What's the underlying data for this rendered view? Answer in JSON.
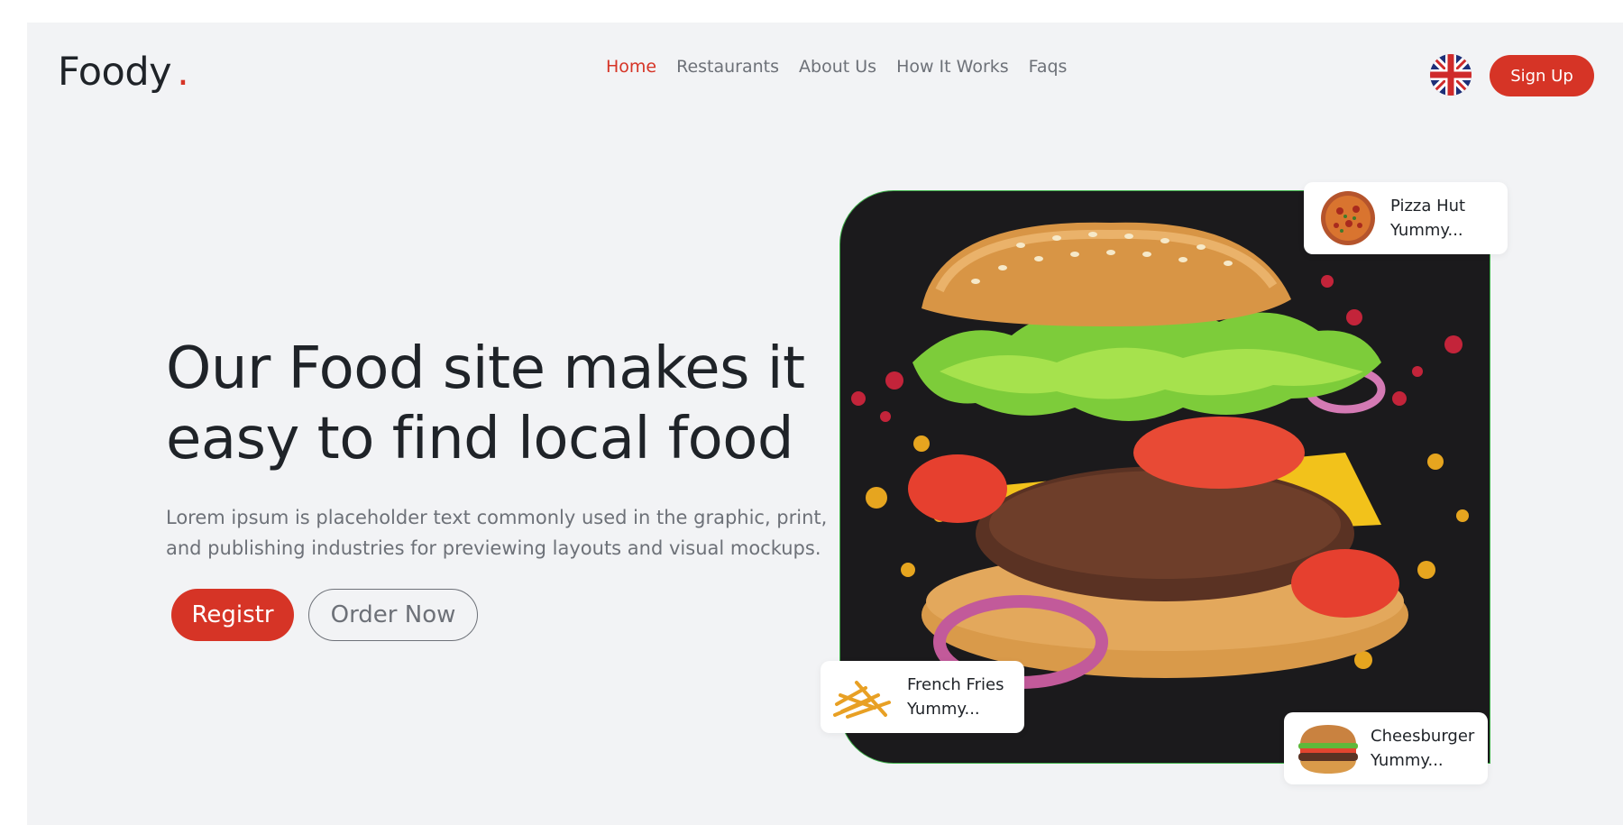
{
  "brand": {
    "name": "Foody",
    "dot": "."
  },
  "nav": {
    "items": [
      {
        "label": "Home",
        "active": true
      },
      {
        "label": "Restaurants",
        "active": false
      },
      {
        "label": "About Us",
        "active": false
      },
      {
        "label": "How It Works",
        "active": false
      },
      {
        "label": "Faqs",
        "active": false
      }
    ]
  },
  "header": {
    "flag_icon": "uk-flag-icon",
    "signup_label": "Sign Up"
  },
  "hero": {
    "title_line1": "Our Food site makes it",
    "title_line2": "easy to find local food",
    "description_line1": "Lorem ipsum is placeholder text commonly used in the graphic, print,",
    "description_line2": "and publishing industries for previewing layouts and visual mockups.",
    "register_label": "Registr",
    "order_label": "Order Now"
  },
  "cards": [
    {
      "title": "Pizza Hut",
      "subtitle": "Yummy...",
      "icon": "pizza-icon"
    },
    {
      "title": "French Fries",
      "subtitle": "Yummy...",
      "icon": "fries-icon"
    },
    {
      "title": "Cheesburger",
      "subtitle": "Yummy...",
      "icon": "burger-icon"
    }
  ],
  "colors": {
    "accent": "#d63426",
    "text": "#1f2328",
    "muted": "#6d7178",
    "background": "#f2f3f5",
    "panel": "#1b1a1c",
    "panel_border": "#3fb24a"
  }
}
